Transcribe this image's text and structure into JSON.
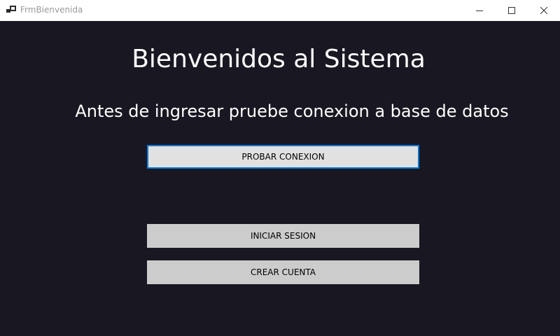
{
  "window": {
    "title": "FrmBienvenida",
    "app_icon": "form-icon",
    "controls": {
      "minimize_icon": "minimize-icon",
      "maximize_icon": "maximize-icon",
      "close_icon": "close-icon"
    }
  },
  "main": {
    "heading": "Bienvenidos al Sistema",
    "subheading": "Antes de ingresar pruebe conexion a base de datos",
    "buttons": {
      "test_connection": "PROBAR CONEXION",
      "login": "INICIAR SESION",
      "create_account": "CREAR CUENTA"
    }
  },
  "colors": {
    "background": "#191822",
    "text": "#ffffff",
    "button": "#cccccc",
    "button_focused": "#e1e1e1",
    "focus_border": "#0078d7"
  }
}
